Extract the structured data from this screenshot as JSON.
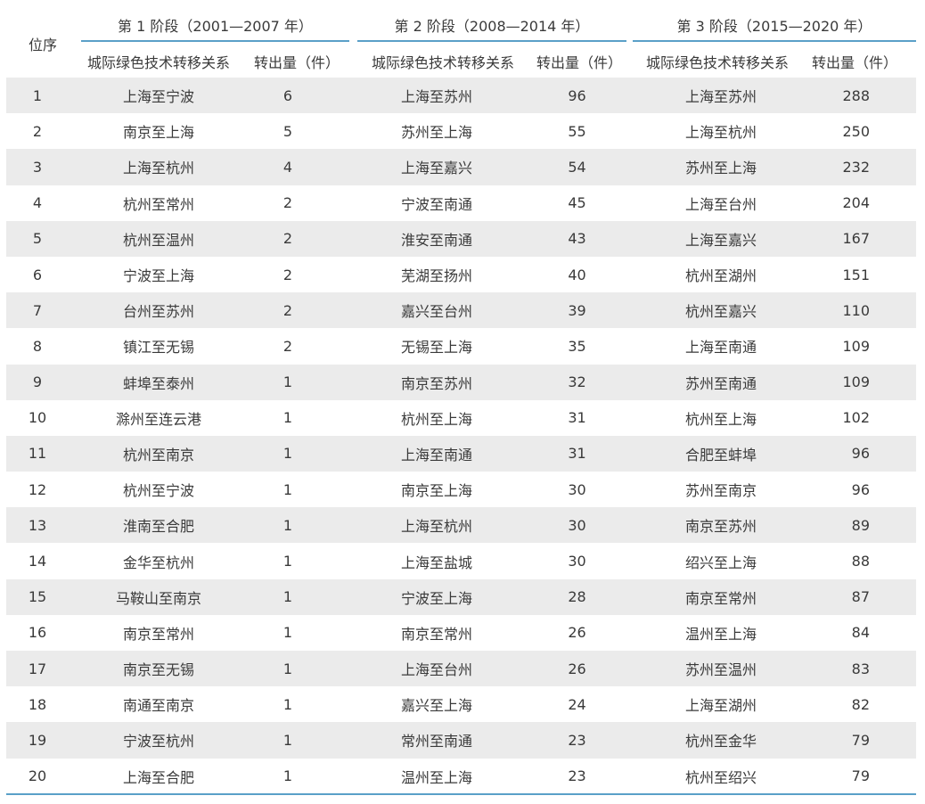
{
  "header": {
    "rank_label": "位序",
    "stages": [
      {
        "title": "第 1 阶段（2001—2007 年）",
        "col_relation": "城际绿色技术转移关系",
        "col_count": "转出量（件）"
      },
      {
        "title": "第 2 阶段（2008—2014 年）",
        "col_relation": "城际绿色技术转移关系",
        "col_count": "转出量（件）"
      },
      {
        "title": "第 3 阶段（2015—2020 年）",
        "col_relation": "城际绿色技术转移关系",
        "col_count": "转出量（件）"
      }
    ]
  },
  "rows": [
    {
      "rank": "1",
      "s1_rel": "上海至宁波",
      "s1_cnt": "6",
      "s2_rel": "上海至苏州",
      "s2_cnt": "96",
      "s3_rel": "上海至苏州",
      "s3_cnt": "288"
    },
    {
      "rank": "2",
      "s1_rel": "南京至上海",
      "s1_cnt": "5",
      "s2_rel": "苏州至上海",
      "s2_cnt": "55",
      "s3_rel": "上海至杭州",
      "s3_cnt": "250"
    },
    {
      "rank": "3",
      "s1_rel": "上海至杭州",
      "s1_cnt": "4",
      "s2_rel": "上海至嘉兴",
      "s2_cnt": "54",
      "s3_rel": "苏州至上海",
      "s3_cnt": "232"
    },
    {
      "rank": "4",
      "s1_rel": "杭州至常州",
      "s1_cnt": "2",
      "s2_rel": "宁波至南通",
      "s2_cnt": "45",
      "s3_rel": "上海至台州",
      "s3_cnt": "204"
    },
    {
      "rank": "5",
      "s1_rel": "杭州至温州",
      "s1_cnt": "2",
      "s2_rel": "淮安至南通",
      "s2_cnt": "43",
      "s3_rel": "上海至嘉兴",
      "s3_cnt": "167"
    },
    {
      "rank": "6",
      "s1_rel": "宁波至上海",
      "s1_cnt": "2",
      "s2_rel": "芜湖至扬州",
      "s2_cnt": "40",
      "s3_rel": "杭州至湖州",
      "s3_cnt": "151"
    },
    {
      "rank": "7",
      "s1_rel": "台州至苏州",
      "s1_cnt": "2",
      "s2_rel": "嘉兴至台州",
      "s2_cnt": "39",
      "s3_rel": "杭州至嘉兴",
      "s3_cnt": "110"
    },
    {
      "rank": "8",
      "s1_rel": "镇江至无锡",
      "s1_cnt": "2",
      "s2_rel": "无锡至上海",
      "s2_cnt": "35",
      "s3_rel": "上海至南通",
      "s3_cnt": "109"
    },
    {
      "rank": "9",
      "s1_rel": "蚌埠至泰州",
      "s1_cnt": "1",
      "s2_rel": "南京至苏州",
      "s2_cnt": "32",
      "s3_rel": "苏州至南通",
      "s3_cnt": "109"
    },
    {
      "rank": "10",
      "s1_rel": "滁州至连云港",
      "s1_cnt": "1",
      "s2_rel": "杭州至上海",
      "s2_cnt": "31",
      "s3_rel": "杭州至上海",
      "s3_cnt": "102"
    },
    {
      "rank": "11",
      "s1_rel": "杭州至南京",
      "s1_cnt": "1",
      "s2_rel": "上海至南通",
      "s2_cnt": "31",
      "s3_rel": "合肥至蚌埠",
      "s3_cnt": "96"
    },
    {
      "rank": "12",
      "s1_rel": "杭州至宁波",
      "s1_cnt": "1",
      "s2_rel": "南京至上海",
      "s2_cnt": "30",
      "s3_rel": "苏州至南京",
      "s3_cnt": "96"
    },
    {
      "rank": "13",
      "s1_rel": "淮南至合肥",
      "s1_cnt": "1",
      "s2_rel": "上海至杭州",
      "s2_cnt": "30",
      "s3_rel": "南京至苏州",
      "s3_cnt": "89"
    },
    {
      "rank": "14",
      "s1_rel": "金华至杭州",
      "s1_cnt": "1",
      "s2_rel": "上海至盐城",
      "s2_cnt": "30",
      "s3_rel": "绍兴至上海",
      "s3_cnt": "88"
    },
    {
      "rank": "15",
      "s1_rel": "马鞍山至南京",
      "s1_cnt": "1",
      "s2_rel": "宁波至上海",
      "s2_cnt": "28",
      "s3_rel": "南京至常州",
      "s3_cnt": "87"
    },
    {
      "rank": "16",
      "s1_rel": "南京至常州",
      "s1_cnt": "1",
      "s2_rel": "南京至常州",
      "s2_cnt": "26",
      "s3_rel": "温州至上海",
      "s3_cnt": "84"
    },
    {
      "rank": "17",
      "s1_rel": "南京至无锡",
      "s1_cnt": "1",
      "s2_rel": "上海至台州",
      "s2_cnt": "26",
      "s3_rel": "苏州至温州",
      "s3_cnt": "83"
    },
    {
      "rank": "18",
      "s1_rel": "南通至南京",
      "s1_cnt": "1",
      "s2_rel": "嘉兴至上海",
      "s2_cnt": "24",
      "s3_rel": "上海至湖州",
      "s3_cnt": "82"
    },
    {
      "rank": "19",
      "s1_rel": "宁波至杭州",
      "s1_cnt": "1",
      "s2_rel": "常州至南通",
      "s2_cnt": "23",
      "s3_rel": "杭州至金华",
      "s3_cnt": "79"
    },
    {
      "rank": "20",
      "s1_rel": "上海至合肥",
      "s1_cnt": "1",
      "s2_rel": "温州至上海",
      "s2_cnt": "23",
      "s3_rel": "杭州至绍兴",
      "s3_cnt": "79"
    }
  ],
  "colors": {
    "rule": "#5aa0c8",
    "stripe": "#ebebeb",
    "text": "#3a3a3a"
  }
}
